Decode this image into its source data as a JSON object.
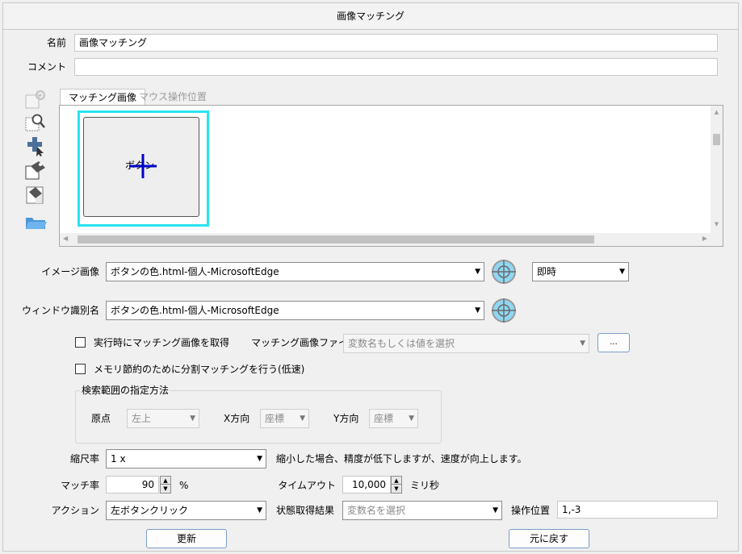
{
  "window": {
    "title": "画像マッチング"
  },
  "fields": {
    "name_label": "名前",
    "name_value": "画像マッチング",
    "comment_label": "コメント",
    "comment_value": ""
  },
  "tabs": [
    {
      "label": "マッチング画像"
    },
    {
      "label": "マウス操作位置"
    }
  ],
  "preview": {
    "button_text": "ボタン"
  },
  "image": {
    "label": "イメージ画像",
    "value": "ボタンの色.html-個人-MicrosoftEdge",
    "timing": "即時"
  },
  "window_id": {
    "label": "ウィンドウ識別名",
    "value": "ボタンの色.html-個人-MicrosoftEdge"
  },
  "options": {
    "capture_at_runtime": "実行時にマッチング画像を取得",
    "matching_file_label": "マッチング画像ファイル",
    "matching_file_placeholder": "変数名もしくは値を選択",
    "browse_button": "...",
    "split_matching": "メモリ節約のために分割マッチングを行う(低速)"
  },
  "search_range": {
    "title": "検索範囲の指定方法",
    "origin_label": "原点",
    "origin_value": "左上",
    "x_label": "X方向",
    "x_value": "座標",
    "y_label": "Y方向",
    "y_value": "座標"
  },
  "scale": {
    "label": "縮尺率",
    "value": "1 x",
    "note": "縮小した場合、精度が低下しますが、速度が向上します。"
  },
  "match": {
    "label": "マッチ率",
    "value": "90",
    "unit": "%",
    "timeout_label": "タイムアウト",
    "timeout_value": "10,000",
    "timeout_unit": "ミリ秒"
  },
  "action": {
    "label": "アクション",
    "value": "左ボタンクリック",
    "status_label": "状態取得結果",
    "status_placeholder": "変数名を選択",
    "position_label": "操作位置",
    "position_value": "1,-3"
  },
  "buttons": {
    "update": "更新",
    "revert": "元に戻す"
  },
  "colors": {
    "selection": "#28e4ee",
    "crosshair": "#0000cc",
    "button_border": "#7a9cc6"
  }
}
